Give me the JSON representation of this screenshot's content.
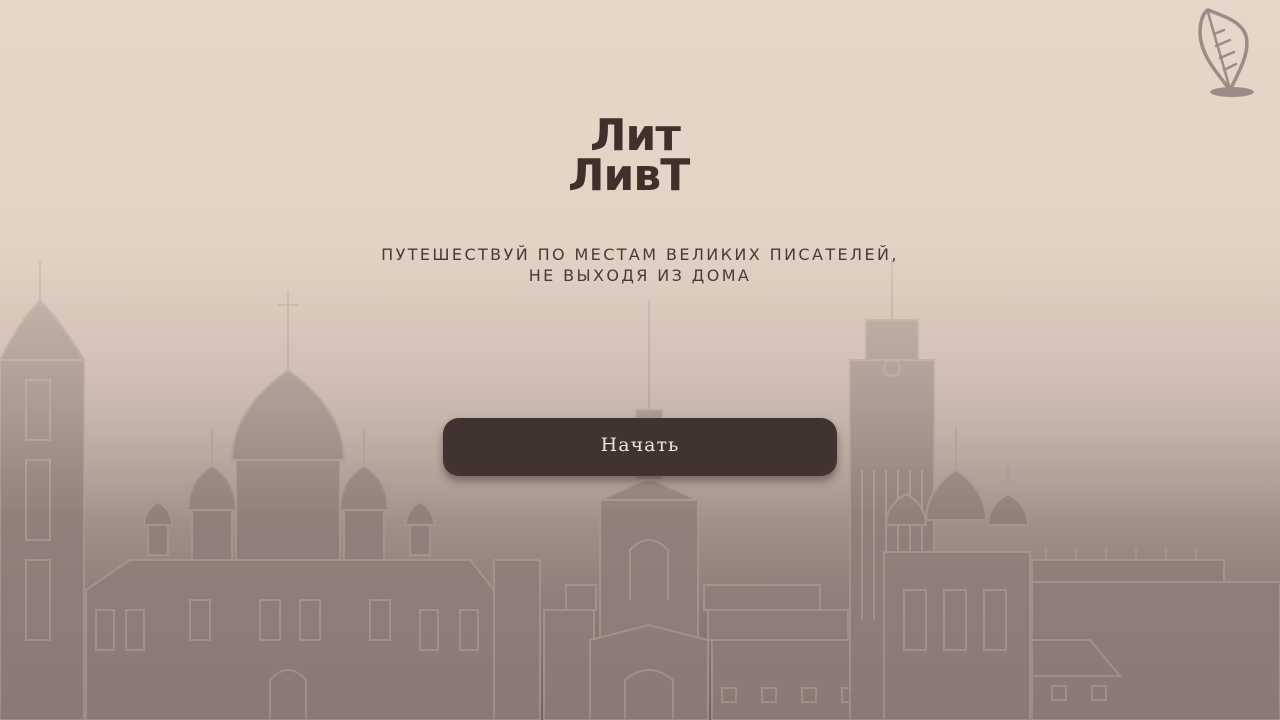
{
  "logo": {
    "line1": "Лит",
    "line2": "ЛивТ"
  },
  "tagline": {
    "line1": "ПУТЕШЕСТВУЙ ПО МЕСТАМ ВЕЛИКИХ ПИСАТЕЛЕЙ,",
    "line2": "НЕ ВЫХОДЯ ИЗ ДОМА"
  },
  "start_button": {
    "label": "Начать"
  },
  "icons": {
    "top_right": "quill-icon",
    "background": "city-skyline"
  },
  "colors": {
    "background_top": "#e6d6c8",
    "background_bottom": "#75625f",
    "text_dark": "#3f302c",
    "button": "#41332f",
    "button_text": "#efe3da"
  }
}
